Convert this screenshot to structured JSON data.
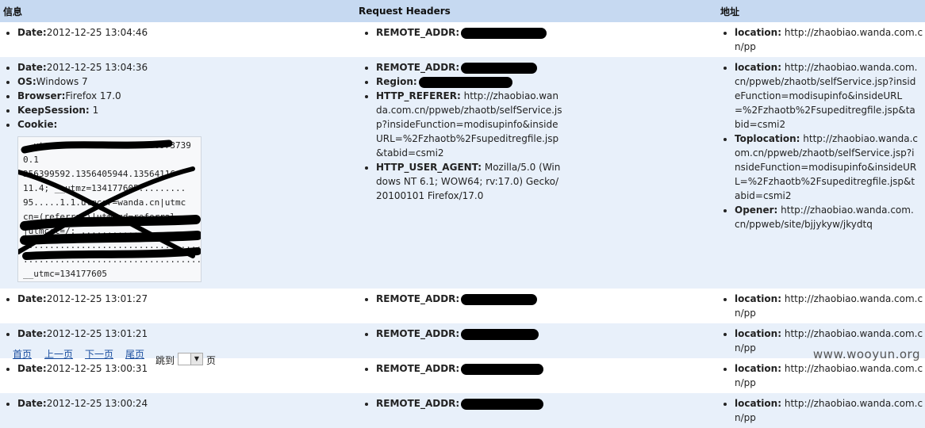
{
  "headers": {
    "col1": "信息",
    "col2": "Request Headers",
    "col3": "地址"
  },
  "rows": [
    {
      "date": "2012-12-25 13:04:46",
      "remote_addr": "",
      "location": "http://zhaobiao.wanda.com.cn/pp"
    },
    {
      "date": "2012-12-25 13:04:36",
      "os": "Windows 7",
      "browser": "Firefox 17.0",
      "keepsession": "1",
      "cookie_lines": [
        "__utma=134...............09737390.1",
        "356399592.1356405944.13564116",
        "11.4; __utmz=134177605.........",
        "95.....1.1.utmcsr=wanda.cn|utmc",
        "cn=(referral)|utmcmd=referral",
        "|utmcct=/; ..................",
        "..................................",
        "......................................",
        "__utmc=134177605"
      ],
      "referer": "http://zhaobiao.wanda.com.cn/ppweb/zhaotb/selfService.jsp?insideFunction=modisupinfo&insideURL=%2Fzhaotb%2Fsupeditregfile.jsp&tabid=csmi2",
      "user_agent": "Mozilla/5.0 (Windows NT 6.1; WOW64; rv:17.0) Gecko/20100101 Firefox/17.0",
      "location": "http://zhaobiao.wanda.com.cn/ppweb/zhaotb/selfService.jsp?insideFunction=modisupinfo&insideURL=%2Fzhaotb%2Fsupeditregfile.jsp&tabid=csmi2",
      "toplocation": "http://zhaobiao.wanda.com.cn/ppweb/zhaotb/selfService.jsp?insideFunction=modisupinfo&insideURL=%2Fzhaotb%2Fsupeditregfile.jsp&tabid=csmi2",
      "opener": "http://zhaobiao.wanda.com.cn/ppweb/site/bjjykyw/jkydtq"
    },
    {
      "date": "2012-12-25 13:01:27",
      "location": "http://zhaobiao.wanda.com.cn/pp"
    },
    {
      "date": "2012-12-25 13:01:21",
      "location": "http://zhaobiao.wanda.com.cn/pp"
    },
    {
      "date": "2012-12-25 13:00:31",
      "location": "http://zhaobiao.wanda.com.cn/pp"
    },
    {
      "date": "2012-12-25 13:00:24",
      "location": "http://zhaobiao.wanda.com.cn/pp"
    }
  ],
  "labels": {
    "date": "Date:",
    "os": "OS:",
    "browser": "Browser:",
    "keepsession": "KeepSession:",
    "cookie": "Cookie:",
    "remote_addr": "REMOTE_ADDR:",
    "region": "Region:",
    "referer": "HTTP_REFERER:",
    "user_agent": "HTTP_USER_AGENT:",
    "location": "location:",
    "toplocation": "Toplocation:",
    "opener": "Opener:"
  },
  "pager": {
    "first": "首页",
    "prev": "上一页",
    "next": "下一页",
    "last": "尾页",
    "jump": "跳到",
    "page": "页"
  },
  "watermark": "www.wooyun.org"
}
